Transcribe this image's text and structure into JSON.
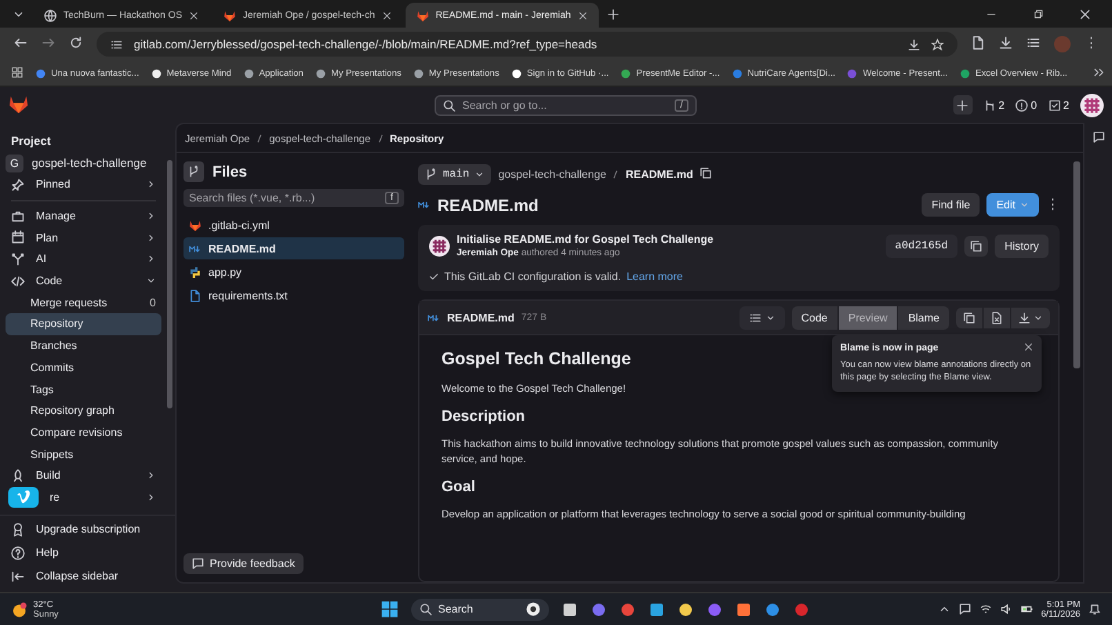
{
  "browser": {
    "tabs": [
      {
        "title": "TechBurn — Hackathon OS",
        "selected": false
      },
      {
        "title": "Jeremiah Ope / gospel-tech-ch",
        "selected": false
      },
      {
        "title": "README.md - main - Jeremiah",
        "selected": true
      }
    ],
    "url": "gitlab.com/Jerryblessed/gospel-tech-challenge/-/blob/main/README.md?ref_type=heads",
    "bookmarks": [
      "Una nuova fantastic...",
      "Metaverse Mind",
      "Application",
      "My Presentations",
      "My Presentations",
      "Sign in to GitHub ·...",
      "PresentMe Editor -...",
      "NutriCare Agents[Di...",
      "Welcome - Present...",
      "Excel Overview - Rib..."
    ]
  },
  "topbar": {
    "search": {
      "placeholder": "Search or go to...",
      "shortcut": "/"
    },
    "counters": [
      "2",
      "0",
      "2"
    ]
  },
  "sidebar": {
    "heading": "Project",
    "project": {
      "initial": "G",
      "name": "gospel-tech-challenge"
    },
    "items": [
      {
        "label": "Pinned",
        "kind": "section",
        "expanded": false,
        "selected": false
      },
      {
        "kind": "divider"
      },
      {
        "label": "Manage",
        "kind": "section",
        "expanded": false,
        "selected": false
      },
      {
        "label": "Plan",
        "kind": "section",
        "expanded": false,
        "selected": false
      },
      {
        "label": "AI",
        "kind": "section",
        "expanded": false,
        "selected": false
      },
      {
        "label": "Code",
        "kind": "section",
        "expanded": true,
        "selected": false
      },
      {
        "label": "Merge requests",
        "kind": "sub",
        "count": "0",
        "selected": false
      },
      {
        "label": "Repository",
        "kind": "sub",
        "selected": true
      },
      {
        "label": "Branches",
        "kind": "sub",
        "selected": false
      },
      {
        "label": "Commits",
        "kind": "sub",
        "selected": false
      },
      {
        "label": "Tags",
        "kind": "sub",
        "selected": false
      },
      {
        "label": "Repository graph",
        "kind": "sub",
        "selected": false
      },
      {
        "label": "Compare revisions",
        "kind": "sub",
        "selected": false
      },
      {
        "label": "Snippets",
        "kind": "sub",
        "selected": false
      },
      {
        "label": "Build",
        "kind": "section",
        "expanded": false,
        "selected": false
      },
      {
        "label": "re",
        "kind": "section",
        "expanded": false,
        "selected": false
      }
    ],
    "footer": [
      "Upgrade subscription",
      "Help",
      "Collapse sidebar"
    ]
  },
  "breadcrumb": [
    "Jeremiah Ope",
    "gospel-tech-challenge",
    "Repository"
  ],
  "files": {
    "title": "Files",
    "search": {
      "placeholder": "Search files (*.vue, *.rb...)",
      "shortcut": "f"
    },
    "items": [
      {
        "name": ".gitlab-ci.yml",
        "selected": false
      },
      {
        "name": "README.md",
        "selected": true
      },
      {
        "name": "app.py",
        "selected": false
      },
      {
        "name": "requirements.txt",
        "selected": false
      }
    ],
    "feedback": "Provide feedback"
  },
  "blob": {
    "branch": "main",
    "path": [
      "gospel-tech-challenge",
      "README.md"
    ],
    "title": "README.md",
    "buttons": [
      "Find file",
      "Edit"
    ],
    "commit": {
      "message": "Initialise README.md for Gospel Tech Challenge",
      "byline": "**Jeremiah Ope** authored 4 minutes ago",
      "sha": "a0d2165d",
      "history": "History"
    },
    "ci": {
      "text": "This GitLab CI configuration is valid.",
      "link": "Learn more"
    },
    "file": {
      "name": "README.md",
      "size": "727 B",
      "views": [
        {
          "label": "Code",
          "selected": false
        },
        {
          "label": "Preview",
          "selected": true
        },
        {
          "label": "Blame",
          "selected": false
        }
      ]
    },
    "readme": [
      {
        "kind": "h1",
        "text": "Gospel Tech Challenge"
      },
      {
        "kind": "p",
        "text": "Welcome to the Gospel Tech Challenge!"
      },
      {
        "kind": "h2",
        "text": "Description"
      },
      {
        "kind": "p",
        "text": "This hackathon aims to build innovative technology solutions that promote gospel values such as compassion, community service, and hope."
      },
      {
        "kind": "h2",
        "text": "Goal"
      },
      {
        "kind": "p",
        "text": "Develop an application or platform that leverages technology to serve a social good or spiritual community-building"
      }
    ],
    "popover": {
      "title": "Blame is now in page",
      "text": "You can now view blame annotations directly on this page by selecting the Blame view."
    }
  },
  "taskbar": {
    "temperature": "32°C",
    "weather": "Sunny",
    "search": "Search",
    "time": "5:01 PM",
    "date": "6/11/2026"
  }
}
